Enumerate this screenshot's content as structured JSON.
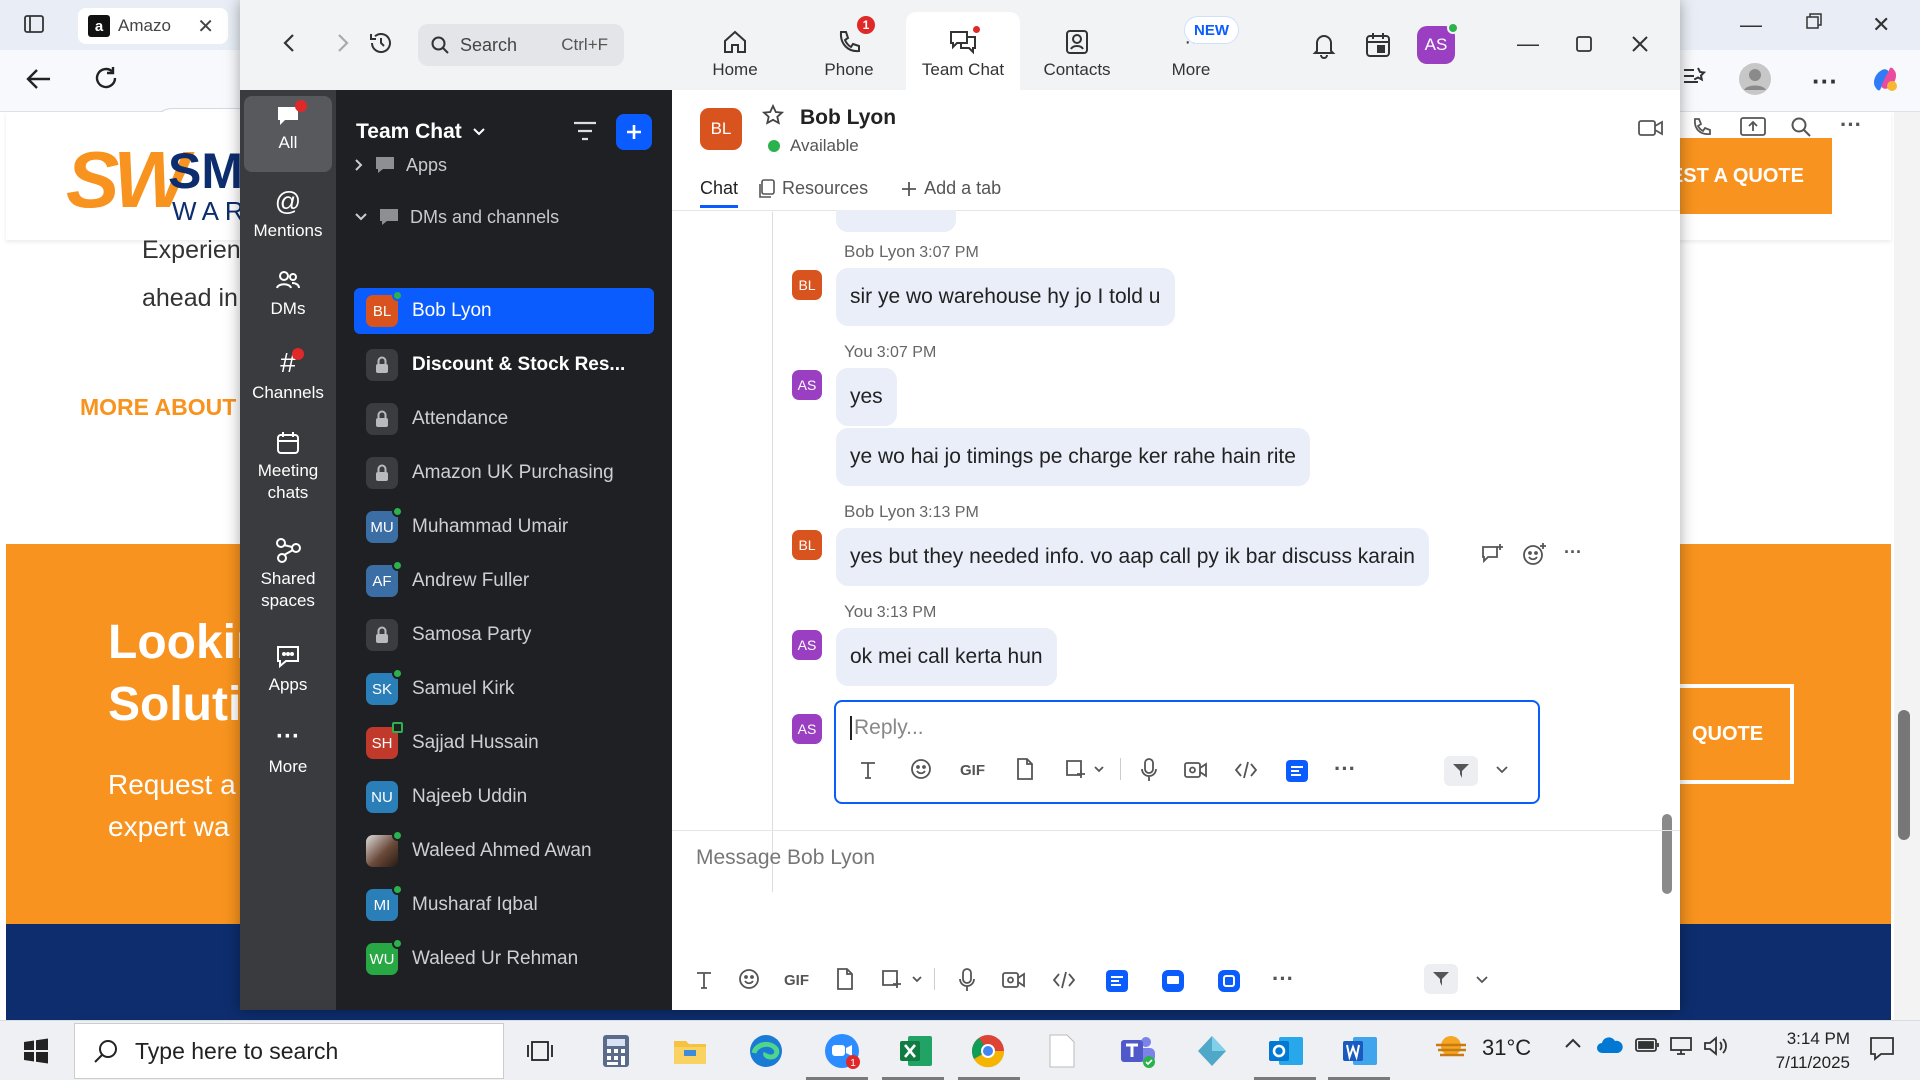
{
  "browser": {
    "tab_title": "Amazo",
    "address_partial": "ht",
    "site": {
      "logo_mark": "SW",
      "logo_sm": "SM",
      "logo_ware": "WARE",
      "header_cta": "EST A QUOTE",
      "text_line1": "Experien",
      "text_line2": "ahead in",
      "more_about": "MORE ABOUT",
      "band_title_line1": "Lookin",
      "band_title_line2": "Soluti",
      "band_sub_line1": "Request a",
      "band_sub_line2": "expert wa",
      "band_cta": "QUOTE"
    }
  },
  "zoom": {
    "search": {
      "label": "Search",
      "shortcut": "Ctrl+F"
    },
    "tabs": [
      {
        "label": "Home",
        "icon": "home-icon"
      },
      {
        "label": "Phone",
        "icon": "phone-icon",
        "badge": "1"
      },
      {
        "label": "Team Chat",
        "icon": "chat-icon",
        "active": true
      },
      {
        "label": "Contacts",
        "icon": "contacts-icon"
      },
      {
        "label": "More",
        "icon": "more-icon",
        "pill": "NEW"
      }
    ],
    "user_initials": "AS",
    "rail": [
      {
        "label": "All",
        "icon": "chat-bubble-icon"
      },
      {
        "label": "Mentions",
        "icon": "at-icon"
      },
      {
        "label": "DMs",
        "icon": "people-icon"
      },
      {
        "label": "Channels",
        "icon": "hash-icon"
      },
      {
        "label": "Meeting chats",
        "line1": "Meeting",
        "line2": "chats",
        "icon": "calendar-icon"
      },
      {
        "label": "Shared spaces",
        "line1": "Shared",
        "line2": "spaces",
        "icon": "shared-icon"
      },
      {
        "label": "Apps",
        "icon": "apps-icon"
      },
      {
        "label": "More",
        "icon": "ellipsis-icon"
      }
    ],
    "list": {
      "title": "Team Chat",
      "sections": {
        "apps": "Apps",
        "dms": "DMs and channels"
      },
      "items": [
        {
          "name": "Bob Lyon",
          "initials": "BL",
          "color": "#d9531e",
          "type": "dm",
          "active": true
        },
        {
          "name": "Discount & Stock Res...",
          "type": "channel",
          "bold": true
        },
        {
          "name": "Attendance",
          "type": "channel"
        },
        {
          "name": "Amazon UK Purchasing",
          "type": "channel"
        },
        {
          "name": "Muhammad Umair",
          "initials": "MU",
          "color": "#3a6ea5",
          "type": "dm"
        },
        {
          "name": "Andrew Fuller",
          "initials": "AF",
          "color": "#3a6ea5",
          "type": "dm"
        },
        {
          "name": "Samosa Party",
          "type": "channel"
        },
        {
          "name": "Samuel Kirk",
          "initials": "SK",
          "color": "#2b7fb8",
          "type": "dm"
        },
        {
          "name": "Sajjad Hussain",
          "initials": "SH",
          "color": "#c0392b",
          "type": "dm"
        },
        {
          "name": "Najeeb Uddin",
          "initials": "NU",
          "color": "#2b7fb8",
          "type": "dm"
        },
        {
          "name": "Waleed Ahmed Awan",
          "initials": "",
          "color": "#6b4a3a",
          "type": "dm"
        },
        {
          "name": "Musharaf Iqbal",
          "initials": "MI",
          "color": "#2b7fb8",
          "type": "dm"
        },
        {
          "name": "Waleed Ur Rehman",
          "initials": "WU",
          "color": "#27a844",
          "type": "dm"
        }
      ]
    },
    "chat": {
      "contact_name": "Bob Lyon",
      "contact_initials": "BL",
      "contact_status": "Available",
      "tabs": {
        "chat": "Chat",
        "resources": "Resources",
        "add": "Add a tab"
      },
      "messages": [
        {
          "sender": "Bob Lyon",
          "time": "3:07 PM",
          "initials": "BL",
          "color": "#d9531e",
          "texts": [
            "sir ye wo warehouse hy jo I told u"
          ]
        },
        {
          "sender": "You",
          "time": "3:07 PM",
          "initials": "AS",
          "color": "#9b3fc2",
          "texts": [
            "yes",
            "ye wo hai jo timings pe charge ker rahe hain rite"
          ]
        },
        {
          "sender": "Bob Lyon",
          "time": "3:13 PM",
          "initials": "BL",
          "color": "#d9531e",
          "texts": [
            "yes but they needed info. vo aap call py ik bar discuss karain"
          ]
        },
        {
          "sender": "You",
          "time": "3:13 PM",
          "initials": "AS",
          "color": "#9b3fc2",
          "texts": [
            "ok mei call kerta hun"
          ]
        }
      ],
      "reply_placeholder": "Reply...",
      "compose_placeholder": "Message Bob Lyon",
      "toolbar_gif": "GIF"
    }
  },
  "taskbar": {
    "search_placeholder": "Type here to search",
    "temperature": "31°C",
    "time": "3:14 PM",
    "date": "7/11/2025",
    "zoom_badge": "1"
  },
  "colors": {
    "accent": "#0b5cff",
    "site_orange": "#f7931e",
    "site_navy": "#0d2d6e",
    "online": "#2bb24c",
    "alert": "#e02828"
  }
}
